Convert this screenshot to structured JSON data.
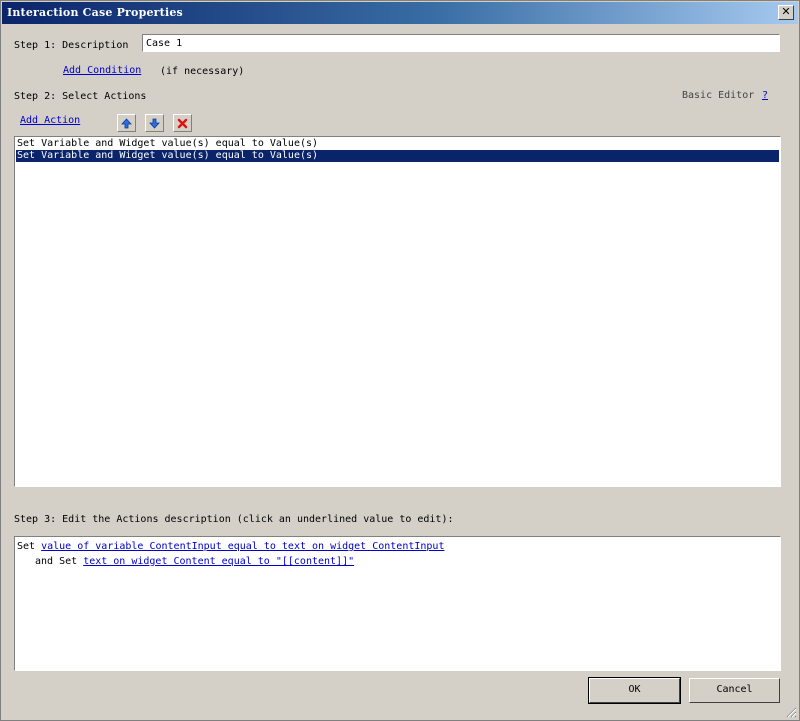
{
  "window": {
    "title": "Interaction Case Properties",
    "close_label": "✕"
  },
  "step1": {
    "label": "Step 1: Description",
    "description_value": "Case 1",
    "add_condition": "Add Condition",
    "condition_note": "(if necessary)"
  },
  "step2": {
    "label": "Step 2: Select Actions",
    "basic_editor": "Basic Editor",
    "help": "?",
    "add_action": "Add Action",
    "toolbar": {
      "up_icon": "arrow-up-icon",
      "down_icon": "arrow-down-icon",
      "delete_icon": "delete-icon"
    },
    "actions": [
      {
        "label": "Set Variable and Widget value(s) equal to Value(s)",
        "selected": false
      },
      {
        "label": "Set Variable and Widget value(s) equal to Value(s)",
        "selected": true
      }
    ]
  },
  "step3": {
    "label": "Step 3: Edit the Actions description (click an underlined value to edit):",
    "line1_prefix": "Set",
    "line1_link": "value of variable ContentInput equal to text on widget ContentInput",
    "line2_prefix": "and Set",
    "line2_link": "text on widget Content equal to \"[[content]]\""
  },
  "buttons": {
    "ok": "OK",
    "cancel": "Cancel"
  },
  "colors": {
    "title_bar": "#0a246a",
    "selection": "#0a246a",
    "link": "#0000cc",
    "face": "#d4d0c8"
  }
}
